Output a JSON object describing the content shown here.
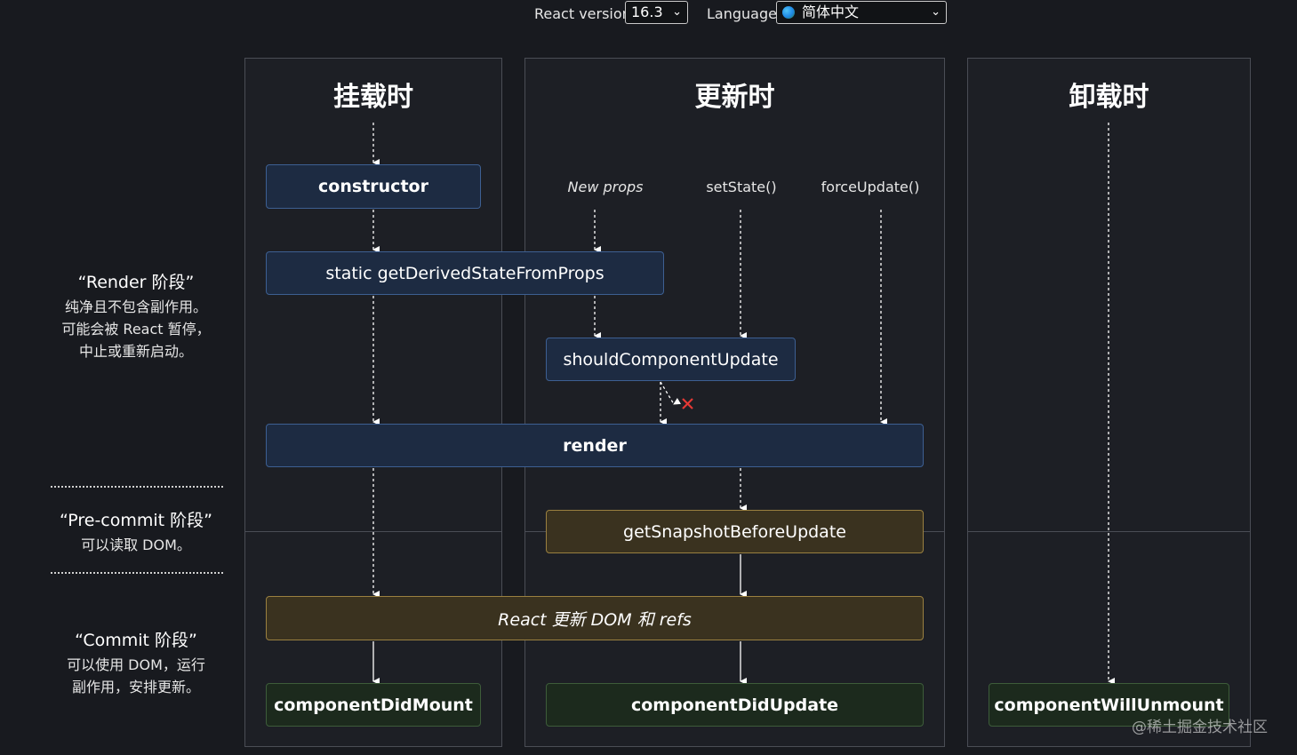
{
  "toolbar": {
    "react_version_label": "React version",
    "react_version_value": "16.3",
    "language_label": "Language",
    "language_value": "简体中文"
  },
  "columns": {
    "mount": "挂载时",
    "update": "更新时",
    "unmount": "卸载时"
  },
  "stages": {
    "render": {
      "title": "“Render 阶段”",
      "lines": [
        "纯净且不包含副作用。",
        "可能会被 React 暂停，",
        "中止或重新启动。"
      ]
    },
    "precommit": {
      "title": "“Pre-commit 阶段”",
      "lines": [
        "可以读取 DOM。"
      ]
    },
    "commit": {
      "title": "“Commit 阶段”",
      "lines": [
        "可以使用 DOM，运行",
        "副作用，安排更新。"
      ]
    }
  },
  "triggers": {
    "new_props": "New props",
    "set_state": "setState()",
    "force_update": "forceUpdate()"
  },
  "boxes": {
    "constructor": "constructor",
    "gdsfp": "static getDerivedStateFromProps",
    "scu": "shouldComponentUpdate",
    "render": "render",
    "gsbu": "getSnapshotBeforeUpdate",
    "react_updates": "React 更新 DOM 和 refs",
    "cdm": "componentDidMount",
    "cdu": "componentDidUpdate",
    "cwu": "componentWillUnmount"
  },
  "watermark": "@稀土掘金技术社区",
  "colors": {
    "background": "#181a1f",
    "panel": "#1d1f25",
    "render_phase_box": "#1d2b42",
    "precommit_box": "#3a321f",
    "commit_box": "#1c2a1d",
    "reject_mark": "#e53935"
  }
}
